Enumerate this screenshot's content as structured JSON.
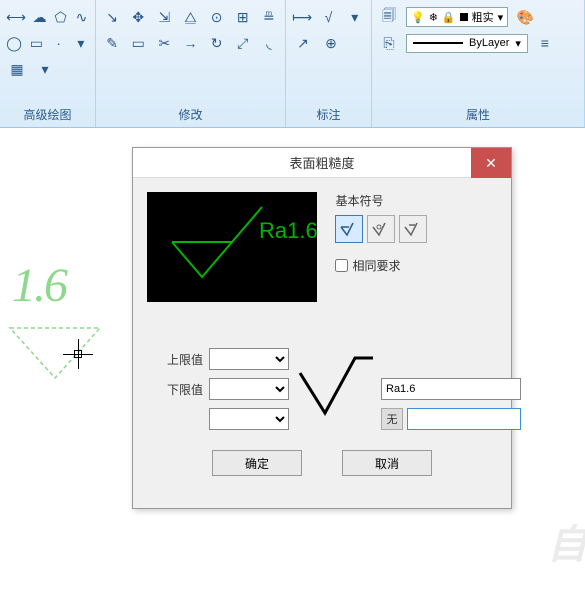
{
  "ribbon": {
    "groups": [
      {
        "label": "高级绘图"
      },
      {
        "label": "修改"
      },
      {
        "label": "标注"
      },
      {
        "label": "属性"
      }
    ],
    "lineweight_label": "粗实",
    "bylayer_label": "ByLayer"
  },
  "canvas": {
    "ghost_value": "1.6"
  },
  "dialog": {
    "title": "表面粗糙度",
    "close": "✕",
    "preview_text": "Ra1.6",
    "symbol_section_label": "基本符号",
    "same_req_label": "相同要求",
    "upper_label": "上限值",
    "lower_label": "下限值",
    "value_input": "Ra1.6",
    "none_label": "无",
    "ok": "确定",
    "cancel": "取消"
  },
  "watermark": "自"
}
